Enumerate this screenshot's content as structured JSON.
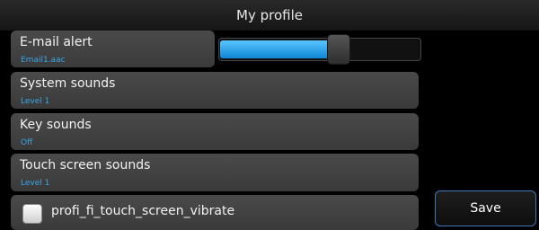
{
  "header": {
    "title": "My profile"
  },
  "settings": {
    "email_alert": {
      "title": "E-mail alert",
      "value": "Email1.aac",
      "volume": 0.59
    },
    "system_sounds": {
      "title": "System sounds",
      "value": "Level 1"
    },
    "key_sounds": {
      "title": "Key sounds",
      "value": "Off"
    },
    "touch_screen_sounds": {
      "title": "Touch screen sounds",
      "value": "Level 1"
    },
    "vibrate": {
      "label": "profi_fi_touch_screen_vibrate",
      "checked": false
    }
  },
  "actions": {
    "save_label": "Save"
  },
  "colors": {
    "accent": "#3aa6e6",
    "slider_fill": "#1ea0ee",
    "item_bg": "#444444"
  }
}
